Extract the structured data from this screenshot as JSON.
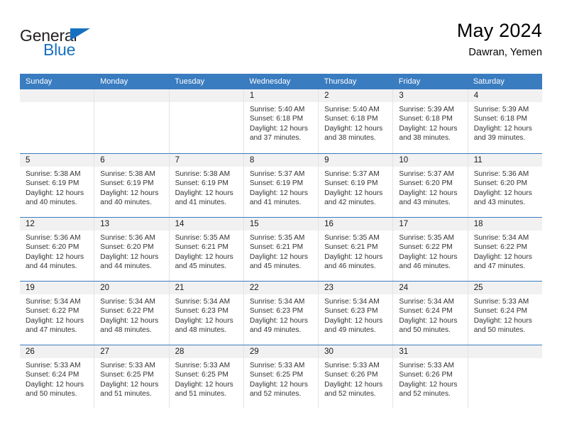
{
  "brand": {
    "name_top": "General",
    "name_bottom": "Blue",
    "triangle_color": "#1670c0",
    "text_color": "#231f20"
  },
  "header": {
    "title": "May 2024",
    "subtitle": "Dawran, Yemen"
  },
  "theme": {
    "header_blue": "#3a7cc0",
    "day_band_gray": "#f1f1f1",
    "cell_border": "#e3e3e3",
    "text": "#333333"
  },
  "weekdays": [
    "Sunday",
    "Monday",
    "Tuesday",
    "Wednesday",
    "Thursday",
    "Friday",
    "Saturday"
  ],
  "weeks": [
    [
      {
        "day": "",
        "empty": true,
        "sunrise": "",
        "sunset": "",
        "daylight_line1": "",
        "daylight_line2": ""
      },
      {
        "day": "",
        "empty": true,
        "sunrise": "",
        "sunset": "",
        "daylight_line1": "",
        "daylight_line2": ""
      },
      {
        "day": "",
        "empty": true,
        "sunrise": "",
        "sunset": "",
        "daylight_line1": "",
        "daylight_line2": ""
      },
      {
        "day": "1",
        "empty": false,
        "sunrise": "Sunrise: 5:40 AM",
        "sunset": "Sunset: 6:18 PM",
        "daylight_line1": "Daylight: 12 hours",
        "daylight_line2": "and 37 minutes."
      },
      {
        "day": "2",
        "empty": false,
        "sunrise": "Sunrise: 5:40 AM",
        "sunset": "Sunset: 6:18 PM",
        "daylight_line1": "Daylight: 12 hours",
        "daylight_line2": "and 38 minutes."
      },
      {
        "day": "3",
        "empty": false,
        "sunrise": "Sunrise: 5:39 AM",
        "sunset": "Sunset: 6:18 PM",
        "daylight_line1": "Daylight: 12 hours",
        "daylight_line2": "and 38 minutes."
      },
      {
        "day": "4",
        "empty": false,
        "sunrise": "Sunrise: 5:39 AM",
        "sunset": "Sunset: 6:18 PM",
        "daylight_line1": "Daylight: 12 hours",
        "daylight_line2": "and 39 minutes."
      }
    ],
    [
      {
        "day": "5",
        "empty": false,
        "sunrise": "Sunrise: 5:38 AM",
        "sunset": "Sunset: 6:19 PM",
        "daylight_line1": "Daylight: 12 hours",
        "daylight_line2": "and 40 minutes."
      },
      {
        "day": "6",
        "empty": false,
        "sunrise": "Sunrise: 5:38 AM",
        "sunset": "Sunset: 6:19 PM",
        "daylight_line1": "Daylight: 12 hours",
        "daylight_line2": "and 40 minutes."
      },
      {
        "day": "7",
        "empty": false,
        "sunrise": "Sunrise: 5:38 AM",
        "sunset": "Sunset: 6:19 PM",
        "daylight_line1": "Daylight: 12 hours",
        "daylight_line2": "and 41 minutes."
      },
      {
        "day": "8",
        "empty": false,
        "sunrise": "Sunrise: 5:37 AM",
        "sunset": "Sunset: 6:19 PM",
        "daylight_line1": "Daylight: 12 hours",
        "daylight_line2": "and 41 minutes."
      },
      {
        "day": "9",
        "empty": false,
        "sunrise": "Sunrise: 5:37 AM",
        "sunset": "Sunset: 6:19 PM",
        "daylight_line1": "Daylight: 12 hours",
        "daylight_line2": "and 42 minutes."
      },
      {
        "day": "10",
        "empty": false,
        "sunrise": "Sunrise: 5:37 AM",
        "sunset": "Sunset: 6:20 PM",
        "daylight_line1": "Daylight: 12 hours",
        "daylight_line2": "and 43 minutes."
      },
      {
        "day": "11",
        "empty": false,
        "sunrise": "Sunrise: 5:36 AM",
        "sunset": "Sunset: 6:20 PM",
        "daylight_line1": "Daylight: 12 hours",
        "daylight_line2": "and 43 minutes."
      }
    ],
    [
      {
        "day": "12",
        "empty": false,
        "sunrise": "Sunrise: 5:36 AM",
        "sunset": "Sunset: 6:20 PM",
        "daylight_line1": "Daylight: 12 hours",
        "daylight_line2": "and 44 minutes."
      },
      {
        "day": "13",
        "empty": false,
        "sunrise": "Sunrise: 5:36 AM",
        "sunset": "Sunset: 6:20 PM",
        "daylight_line1": "Daylight: 12 hours",
        "daylight_line2": "and 44 minutes."
      },
      {
        "day": "14",
        "empty": false,
        "sunrise": "Sunrise: 5:35 AM",
        "sunset": "Sunset: 6:21 PM",
        "daylight_line1": "Daylight: 12 hours",
        "daylight_line2": "and 45 minutes."
      },
      {
        "day": "15",
        "empty": false,
        "sunrise": "Sunrise: 5:35 AM",
        "sunset": "Sunset: 6:21 PM",
        "daylight_line1": "Daylight: 12 hours",
        "daylight_line2": "and 45 minutes."
      },
      {
        "day": "16",
        "empty": false,
        "sunrise": "Sunrise: 5:35 AM",
        "sunset": "Sunset: 6:21 PM",
        "daylight_line1": "Daylight: 12 hours",
        "daylight_line2": "and 46 minutes."
      },
      {
        "day": "17",
        "empty": false,
        "sunrise": "Sunrise: 5:35 AM",
        "sunset": "Sunset: 6:22 PM",
        "daylight_line1": "Daylight: 12 hours",
        "daylight_line2": "and 46 minutes."
      },
      {
        "day": "18",
        "empty": false,
        "sunrise": "Sunrise: 5:34 AM",
        "sunset": "Sunset: 6:22 PM",
        "daylight_line1": "Daylight: 12 hours",
        "daylight_line2": "and 47 minutes."
      }
    ],
    [
      {
        "day": "19",
        "empty": false,
        "sunrise": "Sunrise: 5:34 AM",
        "sunset": "Sunset: 6:22 PM",
        "daylight_line1": "Daylight: 12 hours",
        "daylight_line2": "and 47 minutes."
      },
      {
        "day": "20",
        "empty": false,
        "sunrise": "Sunrise: 5:34 AM",
        "sunset": "Sunset: 6:22 PM",
        "daylight_line1": "Daylight: 12 hours",
        "daylight_line2": "and 48 minutes."
      },
      {
        "day": "21",
        "empty": false,
        "sunrise": "Sunrise: 5:34 AM",
        "sunset": "Sunset: 6:23 PM",
        "daylight_line1": "Daylight: 12 hours",
        "daylight_line2": "and 48 minutes."
      },
      {
        "day": "22",
        "empty": false,
        "sunrise": "Sunrise: 5:34 AM",
        "sunset": "Sunset: 6:23 PM",
        "daylight_line1": "Daylight: 12 hours",
        "daylight_line2": "and 49 minutes."
      },
      {
        "day": "23",
        "empty": false,
        "sunrise": "Sunrise: 5:34 AM",
        "sunset": "Sunset: 6:23 PM",
        "daylight_line1": "Daylight: 12 hours",
        "daylight_line2": "and 49 minutes."
      },
      {
        "day": "24",
        "empty": false,
        "sunrise": "Sunrise: 5:34 AM",
        "sunset": "Sunset: 6:24 PM",
        "daylight_line1": "Daylight: 12 hours",
        "daylight_line2": "and 50 minutes."
      },
      {
        "day": "25",
        "empty": false,
        "sunrise": "Sunrise: 5:33 AM",
        "sunset": "Sunset: 6:24 PM",
        "daylight_line1": "Daylight: 12 hours",
        "daylight_line2": "and 50 minutes."
      }
    ],
    [
      {
        "day": "26",
        "empty": false,
        "sunrise": "Sunrise: 5:33 AM",
        "sunset": "Sunset: 6:24 PM",
        "daylight_line1": "Daylight: 12 hours",
        "daylight_line2": "and 50 minutes."
      },
      {
        "day": "27",
        "empty": false,
        "sunrise": "Sunrise: 5:33 AM",
        "sunset": "Sunset: 6:25 PM",
        "daylight_line1": "Daylight: 12 hours",
        "daylight_line2": "and 51 minutes."
      },
      {
        "day": "28",
        "empty": false,
        "sunrise": "Sunrise: 5:33 AM",
        "sunset": "Sunset: 6:25 PM",
        "daylight_line1": "Daylight: 12 hours",
        "daylight_line2": "and 51 minutes."
      },
      {
        "day": "29",
        "empty": false,
        "sunrise": "Sunrise: 5:33 AM",
        "sunset": "Sunset: 6:25 PM",
        "daylight_line1": "Daylight: 12 hours",
        "daylight_line2": "and 52 minutes."
      },
      {
        "day": "30",
        "empty": false,
        "sunrise": "Sunrise: 5:33 AM",
        "sunset": "Sunset: 6:26 PM",
        "daylight_line1": "Daylight: 12 hours",
        "daylight_line2": "and 52 minutes."
      },
      {
        "day": "31",
        "empty": false,
        "sunrise": "Sunrise: 5:33 AM",
        "sunset": "Sunset: 6:26 PM",
        "daylight_line1": "Daylight: 12 hours",
        "daylight_line2": "and 52 minutes."
      },
      {
        "day": "",
        "empty": true,
        "sunrise": "",
        "sunset": "",
        "daylight_line1": "",
        "daylight_line2": ""
      }
    ]
  ]
}
